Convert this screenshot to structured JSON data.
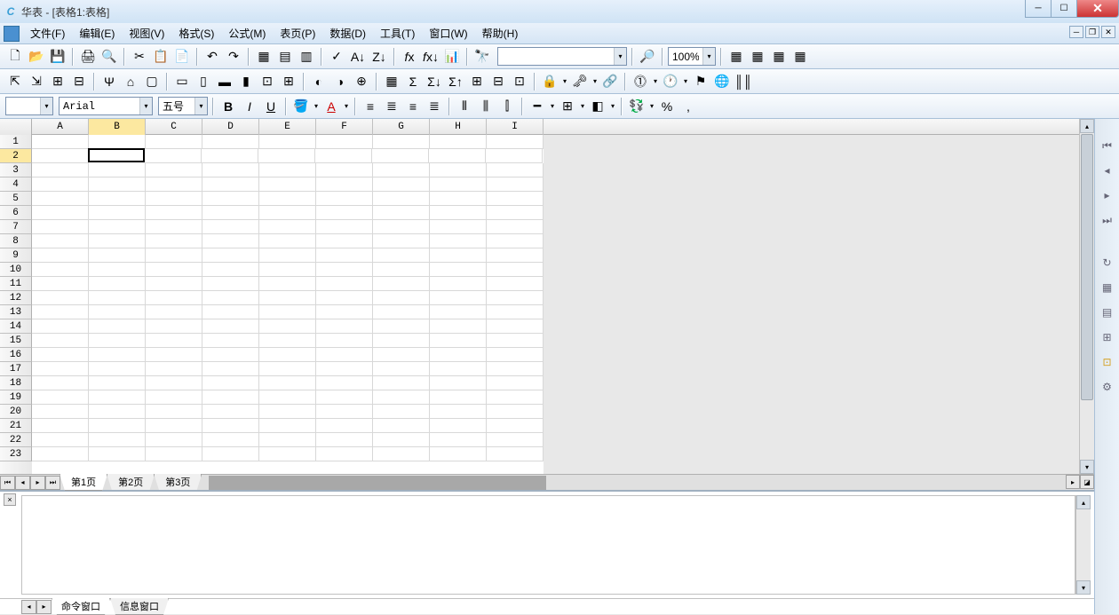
{
  "title": "华表 - [表格1:表格]",
  "menu": {
    "items": [
      "文件(F)",
      "编辑(E)",
      "视图(V)",
      "格式(S)",
      "公式(M)",
      "表页(P)",
      "数据(D)",
      "工具(T)",
      "窗口(W)",
      "帮助(H)"
    ]
  },
  "toolbar1": {
    "zoom": "100%"
  },
  "format": {
    "cell_ref": "",
    "font_name": "Arial",
    "font_size": "五号"
  },
  "columns": [
    "A",
    "B",
    "C",
    "D",
    "E",
    "F",
    "G",
    "H",
    "I"
  ],
  "rows": [
    "1",
    "2",
    "3",
    "4",
    "5",
    "6",
    "7",
    "8",
    "9",
    "10",
    "11",
    "12",
    "13",
    "14",
    "15",
    "16",
    "17",
    "18",
    "19",
    "20",
    "21",
    "22",
    "23"
  ],
  "active_cell": {
    "col": 1,
    "row": 1
  },
  "sheet_tabs": [
    "第1页",
    "第2页",
    "第3页"
  ],
  "active_sheet_tab": 0,
  "output_tabs": [
    "命令窗口",
    "信息窗口"
  ],
  "active_output_tab": 0
}
